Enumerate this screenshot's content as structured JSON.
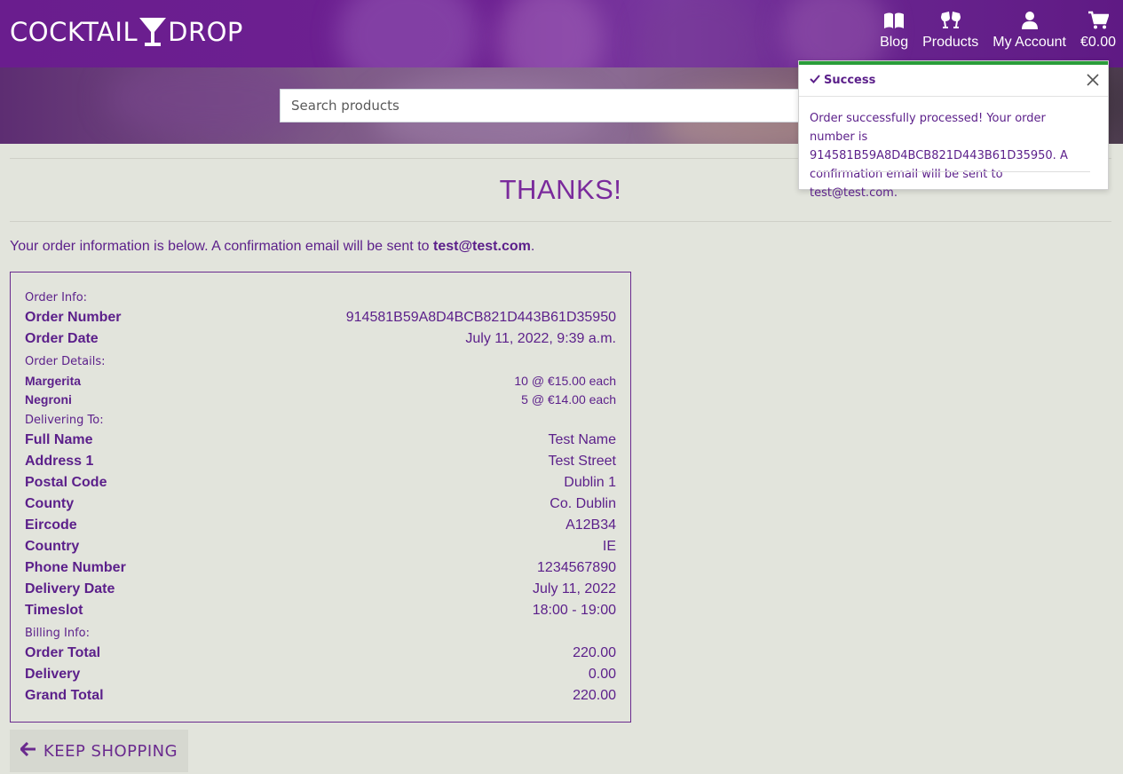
{
  "header": {
    "logo_left": "COCKTAIL",
    "logo_right": "DROP",
    "nav": [
      {
        "label": "Blog",
        "icon": "book-icon"
      },
      {
        "label": "Products",
        "icon": "cheers-glasses-icon"
      },
      {
        "label": "My Account",
        "icon": "user-icon"
      },
      {
        "label": "€0.00",
        "icon": "cart-icon"
      }
    ],
    "search_placeholder": "Search products"
  },
  "main": {
    "title": "THANKS!",
    "intro_text": "Your order information is below. A confirmation email will be sent to ",
    "intro_email": "test@test.com",
    "intro_end": ".",
    "sections": {
      "order_info": "Order Info:",
      "order_details": "Order Details:",
      "delivering_to": "Delivering To:",
      "billing_info": "Billing Info:"
    },
    "order_info": [
      {
        "key": "Order Number",
        "value": "914581B59A8D4BCB821D443B61D35950"
      },
      {
        "key": "Order Date",
        "value": "July 11, 2022, 9:39 a.m."
      }
    ],
    "order_details": [
      {
        "key": "Margerita",
        "value": "10 @ €15.00 each"
      },
      {
        "key": "Negroni",
        "value": "5 @ €14.00 each"
      }
    ],
    "delivering_to": [
      {
        "key": "Full Name",
        "value": "Test Name"
      },
      {
        "key": "Address 1",
        "value": "Test Street"
      },
      {
        "key": "Postal Code",
        "value": "Dublin 1"
      },
      {
        "key": "County",
        "value": "Co. Dublin"
      },
      {
        "key": "Eircode",
        "value": "A12B34"
      },
      {
        "key": "Country",
        "value": "IE"
      },
      {
        "key": "Phone Number",
        "value": "1234567890"
      },
      {
        "key": "Delivery Date",
        "value": "July 11, 2022"
      },
      {
        "key": "Timeslot",
        "value": "18:00 - 19:00"
      }
    ],
    "billing_info": [
      {
        "key": "Order Total",
        "value": "220.00"
      },
      {
        "key": "Delivery",
        "value": "0.00"
      },
      {
        "key": "Grand Total",
        "value": "220.00"
      }
    ],
    "keep_shopping_label": "KEEP SHOPPING"
  },
  "toast": {
    "title": "Success",
    "message": "Order successfully processed! Your order number is 914581B59A8D4BCB821D443B61D35950. A confirmation email will be sent to test@test.com."
  },
  "colors": {
    "brand": "#6a1d8e",
    "text": "#5b1f8a",
    "success": "#2a9d3a",
    "background": "#e2e4dc"
  }
}
